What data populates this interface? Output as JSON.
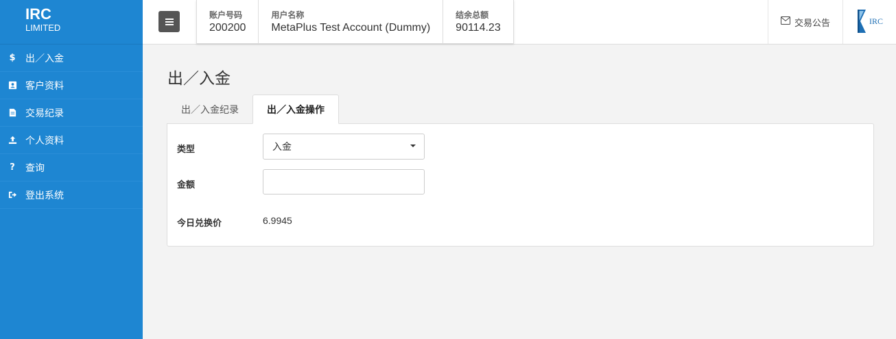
{
  "brand": {
    "main": "IRC",
    "sub": "LIMITED"
  },
  "sidebar": {
    "items": [
      {
        "label": "出／入金",
        "icon": "dollar-icon"
      },
      {
        "label": "客户资料",
        "icon": "contact-card-icon"
      },
      {
        "label": "交易纪录",
        "icon": "document-icon"
      },
      {
        "label": "个人资料",
        "icon": "upload-icon"
      },
      {
        "label": "查询",
        "icon": "question-icon"
      },
      {
        "label": "登出系统",
        "icon": "logout-icon"
      }
    ]
  },
  "topbar": {
    "account": {
      "label": "账户号码",
      "value": "200200"
    },
    "username": {
      "label": "用户名称",
      "value": "MetaPlus Test Account (Dummy)"
    },
    "balance": {
      "label": "结余总额",
      "value": "90114.23"
    },
    "notice_label": "交易公告",
    "logo_text": "IRC"
  },
  "page": {
    "title": "出／入金",
    "tabs": [
      {
        "label": "出／入金纪录",
        "active": false
      },
      {
        "label": "出／入金操作",
        "active": true
      }
    ]
  },
  "form": {
    "type_label": "类型",
    "type_value": "入金",
    "amount_label": "金额",
    "amount_value": "",
    "rate_label": "今日兑换价",
    "rate_value": "6.9945"
  },
  "colors": {
    "sidebar": "#1e86d2",
    "background": "#f3f3f3",
    "menu_button": "#555555"
  }
}
